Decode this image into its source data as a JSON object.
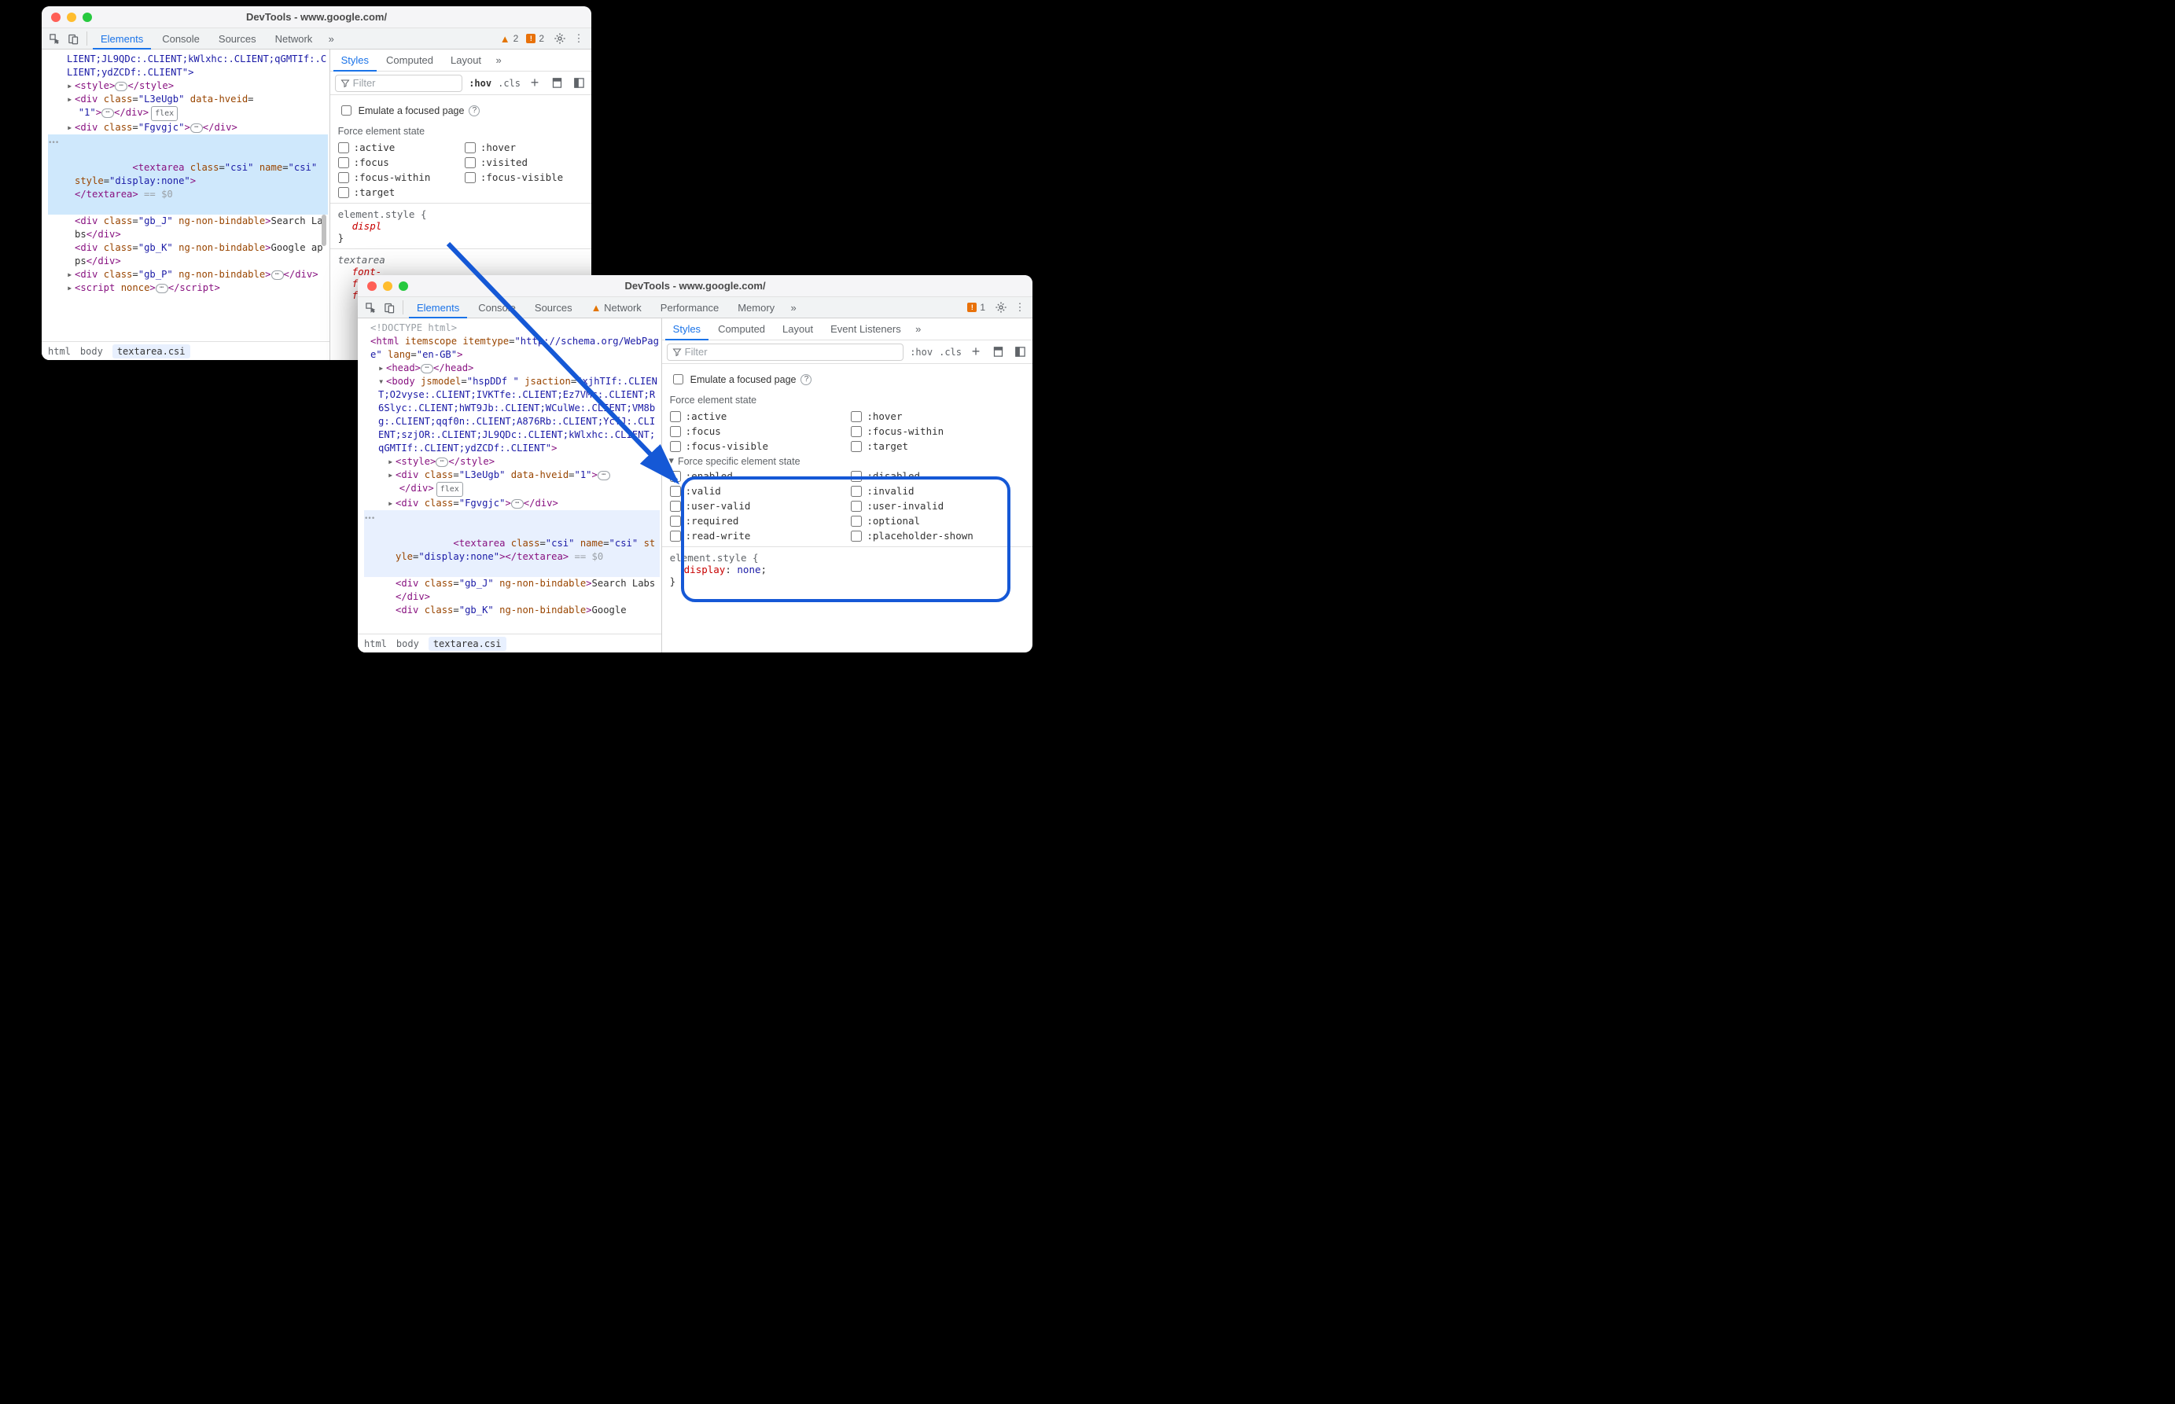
{
  "win1": {
    "title": "DevTools - www.google.com/",
    "tabs": {
      "elements": "Elements",
      "console": "Console",
      "sources": "Sources",
      "network": "Network"
    },
    "warnings": "2",
    "issues": "2",
    "subtabs": {
      "styles": "Styles",
      "computed": "Computed",
      "layout": "Layout"
    },
    "filter_ph": "Filter",
    "hov": ":hov",
    "cls": ".cls",
    "emulate": "Emulate a focused page",
    "force_hdr": "Force element state",
    "states_l": [
      ":active",
      ":focus",
      ":focus-within",
      ":target"
    ],
    "states_r": [
      ":hover",
      ":visited",
      ":focus-visible"
    ],
    "rule_sel": "element.style {",
    "rule_prop": "displ",
    "rule2_sel": "textarea",
    "rule2_p": "font-",
    "crumbs": [
      "html",
      "body",
      "textarea.csi"
    ],
    "dom": {
      "l0": "LIENT;JL9QDc:.CLIENT;kWlxhc:.CLIENT;qGMTIf:.CLIENT;ydZCDf:.CLIENT\">",
      "l1a": "<style>",
      "l1b": "</style>",
      "l2": "<div class=\"L3eUgb\" data-hveid=\"1\">",
      "l2c": "</div>",
      "l3a": "<div class=\"Fgvgjc\">",
      "l3b": "</div>",
      "l4": "<textarea class=\"csi\" name=\"csi\" style=\"display:none\">",
      "l4c": "</textarea>",
      "l4eq": " == $0",
      "l5": "<div class=\"gb_J\" ng-non-bindable>Search Labs</div>",
      "l6": "<div class=\"gb_K\" ng-non-bindable>Google apps</div>",
      "l7a": "<div class=\"gb_P\" ng-non-bindable>",
      "l7b": "</div>",
      "l8a": "<script nonce>",
      "l8b": "</script>",
      "flex": "flex"
    }
  },
  "win2": {
    "title": "DevTools - www.google.com/",
    "tabs": {
      "elements": "Elements",
      "console": "Console",
      "sources": "Sources",
      "network": "Network",
      "performance": "Performance",
      "memory": "Memory"
    },
    "issues": "1",
    "subtabs": {
      "styles": "Styles",
      "computed": "Computed",
      "layout": "Layout",
      "events": "Event Listeners"
    },
    "filter_ph": "Filter",
    "hov": ":hov",
    "cls": ".cls",
    "emulate": "Emulate a focused page",
    "force_hdr": "Force element state",
    "states_l": [
      ":active",
      ":focus",
      ":focus-visible"
    ],
    "states_r": [
      ":hover",
      ":focus-within",
      ":target"
    ],
    "force_spec": "Force specific element state",
    "spec_l": [
      ":enabled",
      ":valid",
      ":user-valid",
      ":required",
      ":read-write"
    ],
    "spec_r": [
      ":disabled",
      ":invalid",
      ":user-invalid",
      ":optional",
      ":placeholder-shown"
    ],
    "rule_sel": "element.style {",
    "rule_prop": "display",
    "rule_val": "none",
    "rule_end": "}",
    "crumbs": [
      "html",
      "body",
      "textarea.csi"
    ],
    "dom": {
      "d0": "<!DOCTYPE html>",
      "d1": "<html itemscope itemtype=\"http://schema.org/WebPage\" lang=\"en-GB\">",
      "d2a": "<head>",
      "d2b": "</head>",
      "d3": "<body jsmodel=\"hspDDf \" jsaction=\"xjhTIf:.CLIENT;O2vyse:.CLIENT;IVKTfe:.CLIENT;Ez7VMc:.CLIENT;R6Slyc:.CLIENT;hWT9Jb:.CLIENT;WCulWe:.CLIENT;VM8bg:.CLIENT;qqf0n:.CLIENT;A876Rb:.CLIENT;YcfJ:.CLIENT;szjOR:.CLIENT;JL9QDc:.CLIENT;kWlxhc:.CLIENT;qGMTIf:.CLIENT;ydZCDf:.CLIENT\">",
      "d4a": "<style>",
      "d4b": "</style>",
      "d5": "<div class=\"L3eUgb\" data-hveid=\"1\">",
      "d5c": "</div>",
      "d6a": "<div class=\"Fgvgjc\">",
      "d6b": "</div>",
      "d7": "<textarea class=\"csi\" name=\"csi\" style=\"display:none\"></textarea>",
      "d7eq": " == $0",
      "d8": "<div class=\"gb_J\" ng-non-bindable>Search Labs</div>",
      "d9": "<div class=\"gb_K\" ng-non-bindable>Google",
      "flex": "flex"
    }
  }
}
